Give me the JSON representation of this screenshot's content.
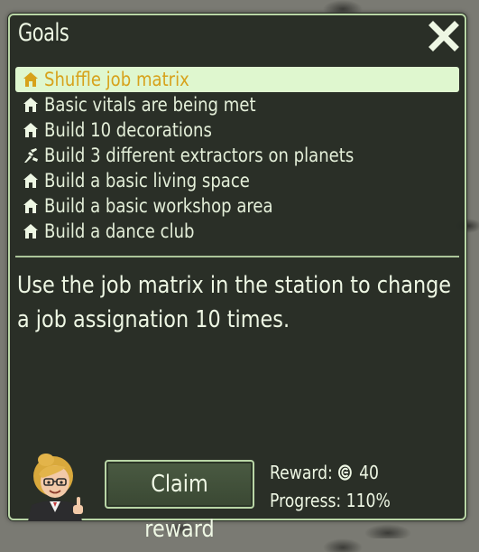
{
  "window": {
    "title": "Goals",
    "close_icon": "close-icon"
  },
  "goals": [
    {
      "label": "Shuffle job matrix",
      "icon": "house-icon",
      "selected": true
    },
    {
      "label": "Basic vitals are being met",
      "icon": "house-icon",
      "selected": false
    },
    {
      "label": "Build 10 decorations",
      "icon": "house-icon",
      "selected": false
    },
    {
      "label": "Build 3 different extractors on planets",
      "icon": "extractor-icon",
      "selected": false
    },
    {
      "label": "Build a basic living space",
      "icon": "house-icon",
      "selected": false
    },
    {
      "label": "Build a basic workshop area",
      "icon": "house-icon",
      "selected": false
    },
    {
      "label": "Build a dance club",
      "icon": "house-icon",
      "selected": false
    }
  ],
  "description": "Use the job matrix in the station to change a job assignation 10 times.",
  "claim_button": "Claim reward",
  "reward": {
    "label": "Reward:",
    "value": "40",
    "icon": "credit-coin-icon"
  },
  "progress": {
    "label": "Progress:",
    "value": "110%"
  },
  "colors": {
    "panel_bg": "#242921",
    "panel_border": "#b9d6a6",
    "selected_bg": "#dff7cf",
    "selected_text": "#d7a21b",
    "text": "#eef7e4"
  }
}
